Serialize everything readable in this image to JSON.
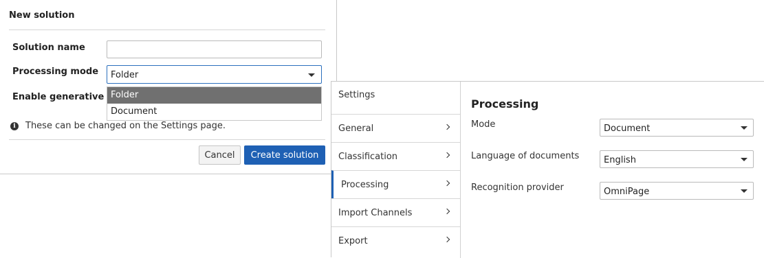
{
  "dialog": {
    "title": "New solution",
    "solution_name_label": "Solution name",
    "solution_name_value": "",
    "processing_mode_label": "Processing mode",
    "processing_mode_value": "Folder",
    "processing_mode_options": [
      "Folder",
      "Document"
    ],
    "genai_label": "Enable generative AI",
    "info_text": "These can be changed on the Settings page.",
    "cancel_label": "Cancel",
    "create_label": "Create solution"
  },
  "settings": {
    "header": "Settings",
    "nav": [
      {
        "label": "General"
      },
      {
        "label": "Classification"
      },
      {
        "label": "Processing",
        "active": true
      },
      {
        "label": "Import Channels"
      },
      {
        "label": "Export"
      }
    ],
    "content": {
      "title": "Processing",
      "rows": [
        {
          "label": "Mode",
          "value": "Document"
        },
        {
          "label": "Language of documents",
          "value": "English"
        },
        {
          "label": "Recognition provider",
          "value": "OmniPage"
        }
      ]
    }
  },
  "colors": {
    "primary": "#1e60b4",
    "dropdown_selected": "#707070"
  },
  "icons": {
    "info": "info-icon",
    "chevron": "chevron-right-icon",
    "caret": "caret-down-icon"
  }
}
